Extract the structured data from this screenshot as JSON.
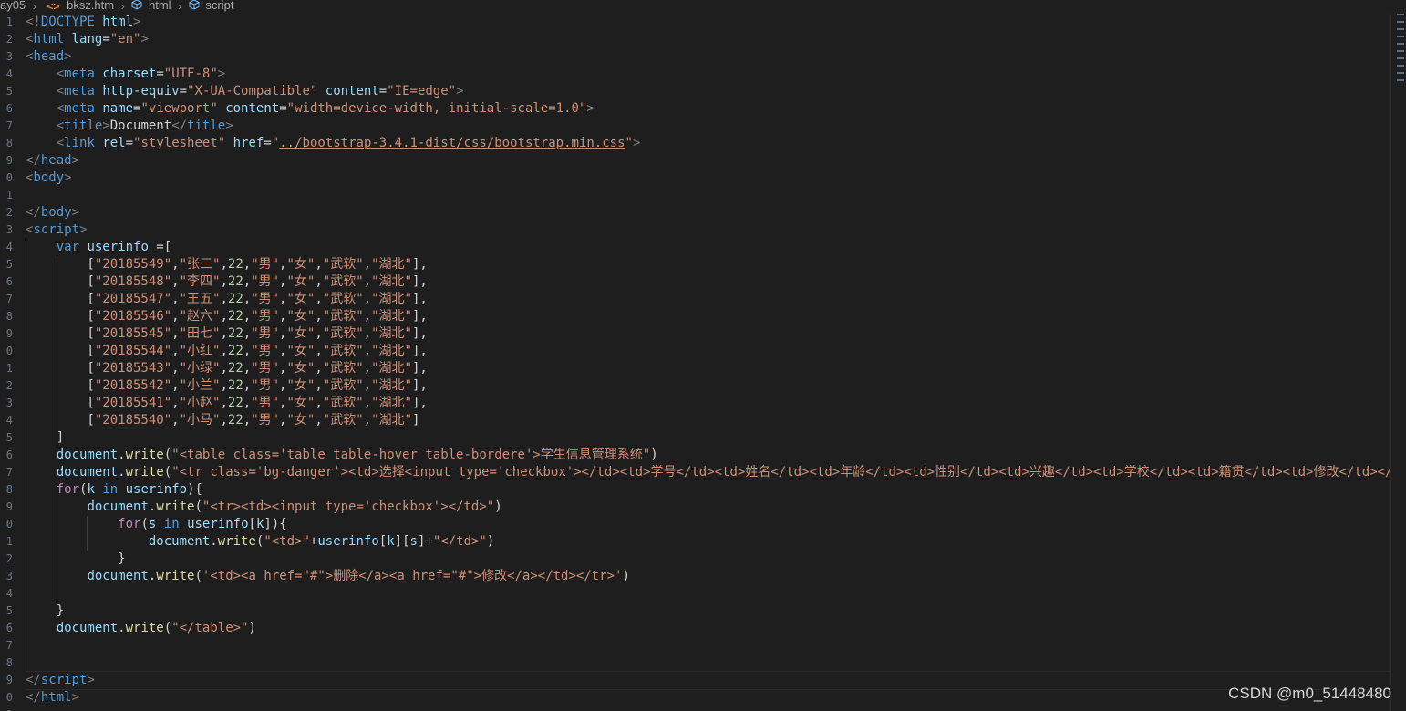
{
  "breadcrumb": [
    "ay05",
    "bksz.htm",
    "html",
    "script"
  ],
  "line_numbers": [
    "1",
    "2",
    "3",
    "4",
    "5",
    "6",
    "7",
    "8",
    "9",
    "0",
    "1",
    "2",
    "3",
    "4",
    "5",
    "6",
    "7",
    "8",
    "9",
    "0",
    "1",
    "2",
    "3",
    "4",
    "5",
    "6",
    "7",
    "8",
    "9",
    "0",
    "1",
    "2",
    "3",
    "4",
    "5",
    "6",
    "7",
    "8",
    "9",
    "0",
    "1"
  ],
  "code_lines": [
    [
      [
        "p",
        "<!"
      ],
      [
        "tag",
        "DOCTYPE "
      ],
      [
        "attr",
        "html"
      ],
      [
        "p",
        ">"
      ]
    ],
    [
      [
        "p",
        "<"
      ],
      [
        "tag",
        "html "
      ],
      [
        "attr",
        "lang"
      ],
      [
        "txt",
        "="
      ],
      [
        "str",
        "\"en\""
      ],
      [
        "p",
        ">"
      ]
    ],
    [
      [
        "p",
        "<"
      ],
      [
        "tag",
        "head"
      ],
      [
        "p",
        ">"
      ]
    ],
    [
      [
        "txt",
        "    "
      ],
      [
        "p",
        "<"
      ],
      [
        "tag",
        "meta "
      ],
      [
        "attr",
        "charset"
      ],
      [
        "txt",
        "="
      ],
      [
        "str",
        "\"UTF-8\""
      ],
      [
        "p",
        ">"
      ]
    ],
    [
      [
        "txt",
        "    "
      ],
      [
        "p",
        "<"
      ],
      [
        "tag",
        "meta "
      ],
      [
        "attr",
        "http-equiv"
      ],
      [
        "txt",
        "="
      ],
      [
        "str",
        "\"X-UA-Compatible\""
      ],
      [
        "txt",
        " "
      ],
      [
        "attr",
        "content"
      ],
      [
        "txt",
        "="
      ],
      [
        "str",
        "\"IE=edge\""
      ],
      [
        "p",
        ">"
      ]
    ],
    [
      [
        "txt",
        "    "
      ],
      [
        "p",
        "<"
      ],
      [
        "tag",
        "meta "
      ],
      [
        "attr",
        "name"
      ],
      [
        "txt",
        "="
      ],
      [
        "str",
        "\"viewport\""
      ],
      [
        "txt",
        " "
      ],
      [
        "attr",
        "content"
      ],
      [
        "txt",
        "="
      ],
      [
        "str",
        "\"width=device-width, initial-scale=1.0\""
      ],
      [
        "p",
        ">"
      ]
    ],
    [
      [
        "txt",
        "    "
      ],
      [
        "p",
        "<"
      ],
      [
        "tag",
        "title"
      ],
      [
        "p",
        ">"
      ],
      [
        "txt",
        "Document"
      ],
      [
        "p",
        "</"
      ],
      [
        "tag",
        "title"
      ],
      [
        "p",
        ">"
      ]
    ],
    [
      [
        "txt",
        "    "
      ],
      [
        "p",
        "<"
      ],
      [
        "tag",
        "link "
      ],
      [
        "attr",
        "rel"
      ],
      [
        "txt",
        "="
      ],
      [
        "str",
        "\"stylesheet\""
      ],
      [
        "txt",
        " "
      ],
      [
        "attr",
        "href"
      ],
      [
        "txt",
        "="
      ],
      [
        "str",
        "\""
      ],
      [
        "link",
        "../bootstrap-3.4.1-dist/css/bootstrap.min.css"
      ],
      [
        "str",
        "\""
      ],
      [
        "p",
        ">"
      ]
    ],
    [
      [
        "p",
        "</"
      ],
      [
        "tag",
        "head"
      ],
      [
        "p",
        ">"
      ]
    ],
    [
      [
        "p",
        "<"
      ],
      [
        "tag",
        "body"
      ],
      [
        "p",
        ">"
      ]
    ],
    [],
    [
      [
        "p",
        "</"
      ],
      [
        "tag",
        "body"
      ],
      [
        "p",
        ">"
      ]
    ],
    [
      [
        "p",
        "<"
      ],
      [
        "tag",
        "script"
      ],
      [
        "p",
        ">"
      ]
    ],
    [
      [
        "txt",
        "    "
      ],
      [
        "tag",
        "var "
      ],
      [
        "attr",
        "userinfo"
      ],
      [
        "txt",
        " =["
      ]
    ],
    [
      [
        "txt",
        "        ["
      ],
      [
        "str",
        "\"20185549\""
      ],
      [
        "txt",
        ","
      ],
      [
        "str",
        "\"张三\""
      ],
      [
        "txt",
        ","
      ],
      [
        "num",
        "22"
      ],
      [
        "txt",
        ","
      ],
      [
        "str",
        "\"男\""
      ],
      [
        "txt",
        ","
      ],
      [
        "str",
        "\"女\""
      ],
      [
        "txt",
        ","
      ],
      [
        "str",
        "\"武软\""
      ],
      [
        "txt",
        ","
      ],
      [
        "str",
        "\"湖北\""
      ],
      [
        "txt",
        "],"
      ]
    ],
    [
      [
        "txt",
        "        ["
      ],
      [
        "str",
        "\"20185548\""
      ],
      [
        "txt",
        ","
      ],
      [
        "str",
        "\"李四\""
      ],
      [
        "txt",
        ","
      ],
      [
        "num",
        "22"
      ],
      [
        "txt",
        ","
      ],
      [
        "str",
        "\"男\""
      ],
      [
        "txt",
        ","
      ],
      [
        "str",
        "\"女\""
      ],
      [
        "txt",
        ","
      ],
      [
        "str",
        "\"武软\""
      ],
      [
        "txt",
        ","
      ],
      [
        "str",
        "\"湖北\""
      ],
      [
        "txt",
        "],"
      ]
    ],
    [
      [
        "txt",
        "        ["
      ],
      [
        "str",
        "\"20185547\""
      ],
      [
        "txt",
        ","
      ],
      [
        "str",
        "\"王五\""
      ],
      [
        "txt",
        ","
      ],
      [
        "num",
        "22"
      ],
      [
        "txt",
        ","
      ],
      [
        "str",
        "\"男\""
      ],
      [
        "txt",
        ","
      ],
      [
        "str",
        "\"女\""
      ],
      [
        "txt",
        ","
      ],
      [
        "str",
        "\"武软\""
      ],
      [
        "txt",
        ","
      ],
      [
        "str",
        "\"湖北\""
      ],
      [
        "txt",
        "],"
      ]
    ],
    [
      [
        "txt",
        "        ["
      ],
      [
        "str",
        "\"20185546\""
      ],
      [
        "txt",
        ","
      ],
      [
        "str",
        "\"赵六\""
      ],
      [
        "txt",
        ","
      ],
      [
        "num",
        "22"
      ],
      [
        "txt",
        ","
      ],
      [
        "str",
        "\"男\""
      ],
      [
        "txt",
        ","
      ],
      [
        "str",
        "\"女\""
      ],
      [
        "txt",
        ","
      ],
      [
        "str",
        "\"武软\""
      ],
      [
        "txt",
        ","
      ],
      [
        "str",
        "\"湖北\""
      ],
      [
        "txt",
        "],"
      ]
    ],
    [
      [
        "txt",
        "        ["
      ],
      [
        "str",
        "\"20185545\""
      ],
      [
        "txt",
        ","
      ],
      [
        "str",
        "\"田七\""
      ],
      [
        "txt",
        ","
      ],
      [
        "num",
        "22"
      ],
      [
        "txt",
        ","
      ],
      [
        "str",
        "\"男\""
      ],
      [
        "txt",
        ","
      ],
      [
        "str",
        "\"女\""
      ],
      [
        "txt",
        ","
      ],
      [
        "str",
        "\"武软\""
      ],
      [
        "txt",
        ","
      ],
      [
        "str",
        "\"湖北\""
      ],
      [
        "txt",
        "],"
      ]
    ],
    [
      [
        "txt",
        "        ["
      ],
      [
        "str",
        "\"20185544\""
      ],
      [
        "txt",
        ","
      ],
      [
        "str",
        "\"小红\""
      ],
      [
        "txt",
        ","
      ],
      [
        "num",
        "22"
      ],
      [
        "txt",
        ","
      ],
      [
        "str",
        "\"男\""
      ],
      [
        "txt",
        ","
      ],
      [
        "str",
        "\"女\""
      ],
      [
        "txt",
        ","
      ],
      [
        "str",
        "\"武软\""
      ],
      [
        "txt",
        ","
      ],
      [
        "str",
        "\"湖北\""
      ],
      [
        "txt",
        "],"
      ]
    ],
    [
      [
        "txt",
        "        ["
      ],
      [
        "str",
        "\"20185543\""
      ],
      [
        "txt",
        ","
      ],
      [
        "str",
        "\"小绿\""
      ],
      [
        "txt",
        ","
      ],
      [
        "num",
        "22"
      ],
      [
        "txt",
        ","
      ],
      [
        "str",
        "\"男\""
      ],
      [
        "txt",
        ","
      ],
      [
        "str",
        "\"女\""
      ],
      [
        "txt",
        ","
      ],
      [
        "str",
        "\"武软\""
      ],
      [
        "txt",
        ","
      ],
      [
        "str",
        "\"湖北\""
      ],
      [
        "txt",
        "],"
      ]
    ],
    [
      [
        "txt",
        "        ["
      ],
      [
        "str",
        "\"20185542\""
      ],
      [
        "txt",
        ","
      ],
      [
        "str",
        "\"小兰\""
      ],
      [
        "txt",
        ","
      ],
      [
        "num",
        "22"
      ],
      [
        "txt",
        ","
      ],
      [
        "str",
        "\"男\""
      ],
      [
        "txt",
        ","
      ],
      [
        "str",
        "\"女\""
      ],
      [
        "txt",
        ","
      ],
      [
        "str",
        "\"武软\""
      ],
      [
        "txt",
        ","
      ],
      [
        "str",
        "\"湖北\""
      ],
      [
        "txt",
        "],"
      ]
    ],
    [
      [
        "txt",
        "        ["
      ],
      [
        "str",
        "\"20185541\""
      ],
      [
        "txt",
        ","
      ],
      [
        "str",
        "\"小赵\""
      ],
      [
        "txt",
        ","
      ],
      [
        "num",
        "22"
      ],
      [
        "txt",
        ","
      ],
      [
        "str",
        "\"男\""
      ],
      [
        "txt",
        ","
      ],
      [
        "str",
        "\"女\""
      ],
      [
        "txt",
        ","
      ],
      [
        "str",
        "\"武软\""
      ],
      [
        "txt",
        ","
      ],
      [
        "str",
        "\"湖北\""
      ],
      [
        "txt",
        "],"
      ]
    ],
    [
      [
        "txt",
        "        ["
      ],
      [
        "str",
        "\"20185540\""
      ],
      [
        "txt",
        ","
      ],
      [
        "str",
        "\"小马\""
      ],
      [
        "txt",
        ","
      ],
      [
        "num",
        "22"
      ],
      [
        "txt",
        ","
      ],
      [
        "str",
        "\"男\""
      ],
      [
        "txt",
        ","
      ],
      [
        "str",
        "\"女\""
      ],
      [
        "txt",
        ","
      ],
      [
        "str",
        "\"武软\""
      ],
      [
        "txt",
        ","
      ],
      [
        "str",
        "\"湖北\""
      ],
      [
        "txt",
        "]"
      ]
    ],
    [
      [
        "txt",
        "    ]"
      ]
    ],
    [
      [
        "txt",
        "    "
      ],
      [
        "attr",
        "document"
      ],
      [
        "txt",
        "."
      ],
      [
        "fn",
        "write"
      ],
      [
        "txt",
        "("
      ],
      [
        "str",
        "\"<table class='table table-hover table-bordere'>学生信息管理系统\""
      ],
      [
        "txt",
        ")"
      ]
    ],
    [
      [
        "txt",
        "    "
      ],
      [
        "attr",
        "document"
      ],
      [
        "txt",
        "."
      ],
      [
        "fn",
        "write"
      ],
      [
        "txt",
        "("
      ],
      [
        "str",
        "\"<tr class='bg-danger'><td>选择<input type='checkbox'></td><td>学号</td><td>姓名</td><td>年龄</td><td>性别</td><td>兴趣</td><td>学校</td><td>籍贯</td><td>修改</td></"
      ]
    ],
    [
      [
        "txt",
        "    "
      ],
      [
        "kw",
        "for"
      ],
      [
        "txt",
        "("
      ],
      [
        "attr",
        "k"
      ],
      [
        "txt",
        " "
      ],
      [
        "tag",
        "in"
      ],
      [
        "txt",
        " "
      ],
      [
        "attr",
        "userinfo"
      ],
      [
        "txt",
        "){"
      ]
    ],
    [
      [
        "txt",
        "        "
      ],
      [
        "attr",
        "document"
      ],
      [
        "txt",
        "."
      ],
      [
        "fn",
        "write"
      ],
      [
        "txt",
        "("
      ],
      [
        "str",
        "\"<tr><td><input type='checkbox'></td>\""
      ],
      [
        "txt",
        ")"
      ]
    ],
    [
      [
        "txt",
        "            "
      ],
      [
        "kw",
        "for"
      ],
      [
        "txt",
        "("
      ],
      [
        "attr",
        "s"
      ],
      [
        "txt",
        " "
      ],
      [
        "tag",
        "in"
      ],
      [
        "txt",
        " "
      ],
      [
        "attr",
        "userinfo"
      ],
      [
        "txt",
        "["
      ],
      [
        "attr",
        "k"
      ],
      [
        "txt",
        "]){"
      ]
    ],
    [
      [
        "txt",
        "                "
      ],
      [
        "attr",
        "document"
      ],
      [
        "txt",
        "."
      ],
      [
        "fn",
        "write"
      ],
      [
        "txt",
        "("
      ],
      [
        "str",
        "\"<td>\""
      ],
      [
        "txt",
        "+"
      ],
      [
        "attr",
        "userinfo"
      ],
      [
        "txt",
        "["
      ],
      [
        "attr",
        "k"
      ],
      [
        "txt",
        "]["
      ],
      [
        "attr",
        "s"
      ],
      [
        "txt",
        "]+"
      ],
      [
        "str",
        "\"</td>\""
      ],
      [
        "txt",
        ")"
      ]
    ],
    [
      [
        "txt",
        "            }"
      ]
    ],
    [
      [
        "txt",
        "        "
      ],
      [
        "attr",
        "document"
      ],
      [
        "txt",
        "."
      ],
      [
        "fn",
        "write"
      ],
      [
        "txt",
        "("
      ],
      [
        "str",
        "'<td><a href=\"#\">删除</a><a href=\"#\">修改</a></td></tr>'"
      ],
      [
        "txt",
        ")"
      ]
    ],
    [],
    [
      [
        "txt",
        "    }"
      ]
    ],
    [
      [
        "txt",
        "    "
      ],
      [
        "attr",
        "document"
      ],
      [
        "txt",
        "."
      ],
      [
        "fn",
        "write"
      ],
      [
        "txt",
        "("
      ],
      [
        "str",
        "\"</table>\""
      ],
      [
        "txt",
        ")"
      ]
    ],
    [],
    [],
    [
      [
        "p",
        "</"
      ],
      [
        "tag",
        "script"
      ],
      [
        "p",
        ">"
      ]
    ],
    [
      [
        "p",
        "</"
      ],
      [
        "tag",
        "html"
      ],
      [
        "p",
        ">"
      ]
    ]
  ],
  "watermark": "CSDN @m0_51448480",
  "colors": {
    "background": "#1e1e1e",
    "tag": "#569cd6",
    "attribute": "#9cdcfe",
    "string": "#ce9178",
    "number": "#b5cea8",
    "keyword": "#c586c0",
    "function": "#dcdcaa",
    "punctuation": "#808080",
    "text": "#d4d4d4"
  }
}
